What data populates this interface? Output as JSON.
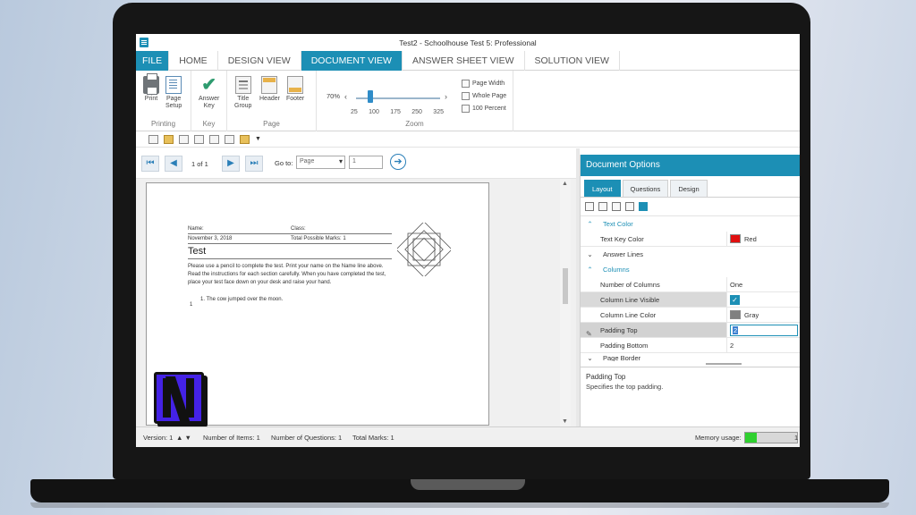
{
  "window": {
    "title": "Test2 - Schoolhouse Test 5: Professional"
  },
  "tabs": [
    {
      "label": "FILE"
    },
    {
      "label": "HOME"
    },
    {
      "label": "DESIGN VIEW"
    },
    {
      "label": "DOCUMENT VIEW",
      "active": true
    },
    {
      "label": "ANSWER SHEET VIEW"
    },
    {
      "label": "SOLUTION VIEW"
    }
  ],
  "ribbon": {
    "printing": {
      "name": "Printing",
      "print": "Print",
      "page_setup_1": "Page",
      "page_setup_2": "Setup"
    },
    "key": {
      "name": "Key",
      "answer_key_1": "Answer",
      "answer_key_2": "Key"
    },
    "page": {
      "name": "Page",
      "title_group_1": "Title",
      "title_group_2": "Group",
      "header": "Header",
      "footer": "Footer"
    },
    "zoom": {
      "name": "Zoom",
      "current": "70%",
      "level_percent": 70,
      "ticks": [
        "25",
        "100",
        "175",
        "250",
        "325"
      ],
      "page_width": "Page Width",
      "whole_page": "Whole Page",
      "hundred_percent": "100 Percent"
    }
  },
  "navigation": {
    "page_count": "1 of 1",
    "goto_label": "Go to:",
    "goto_type": "Page",
    "goto_value": "1"
  },
  "document": {
    "name_label": "Name:",
    "class_label": "Class:",
    "date": "November 3, 2018",
    "total_marks": "Total Possible Marks: 1",
    "title": "Test",
    "instructions": "Please use a pencil to complete the test. Print your name on the Name line above. Read the instructions for each section carefully. When you have completed the test, place your test face down on your desk and raise your hand.",
    "question_1": "1.   The cow jumped over the moon.",
    "mark_fraction": "1"
  },
  "options_panel": {
    "title": "Document Options",
    "tabs": [
      "Layout",
      "Questions",
      "Design"
    ],
    "active_tab": "Layout",
    "categories": {
      "text_color": "Text Color",
      "answer_lines": "Answer Lines",
      "columns": "Columns",
      "page_border": "Page Border"
    },
    "rows": {
      "text_key_color": {
        "label": "Text Key Color",
        "value": "Red",
        "color": "#e01010"
      },
      "number_of_columns": {
        "label": "Number of Columns",
        "value": "One"
      },
      "column_line_visible": {
        "label": "Column Line Visible",
        "checked": true
      },
      "column_line_color": {
        "label": "Column Line Color",
        "value": "Gray",
        "color": "#808080"
      },
      "padding_top": {
        "label": "Padding Top",
        "value": "2"
      },
      "padding_bottom": {
        "label": "Padding Bottom",
        "value": "2"
      }
    },
    "description": {
      "title": "Padding Top",
      "body": "Specifies the top padding."
    }
  },
  "status_bar": {
    "version": "Version: 1",
    "items": "Number of Items: 1",
    "questions": "Number of Questions: 1",
    "marks": "Total Marks: 1",
    "memory_label": "Memory usage:",
    "memory_fraction": 0.22,
    "memory_end": "1"
  },
  "colors": {
    "accent": "#1c8fb5",
    "memory_green": "#2fd02f"
  }
}
